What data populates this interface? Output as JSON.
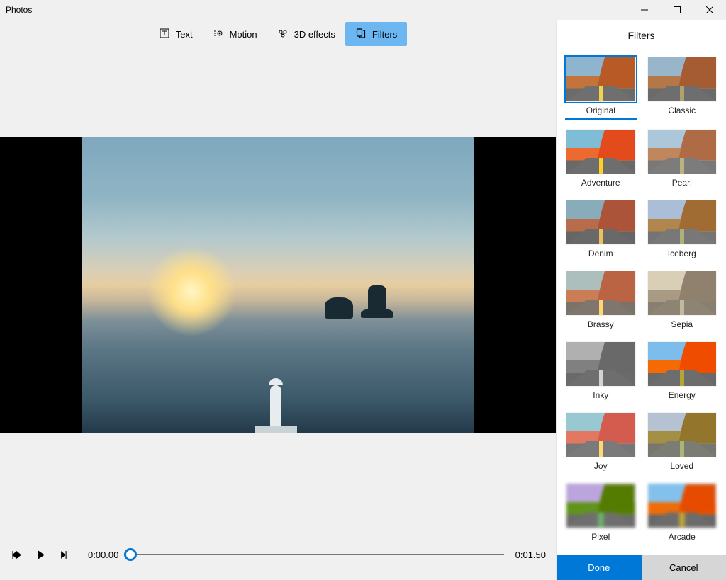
{
  "app": {
    "title": "Photos"
  },
  "window_controls": {
    "minimize": "minimize",
    "maximize": "maximize",
    "close": "close"
  },
  "toolbar": {
    "items": [
      {
        "id": "text",
        "label": "Text",
        "icon": "text-icon",
        "active": false
      },
      {
        "id": "motion",
        "label": "Motion",
        "icon": "motion-icon",
        "active": false
      },
      {
        "id": "3deffects",
        "label": "3D effects",
        "icon": "3d-effects-icon",
        "active": false
      },
      {
        "id": "filters",
        "label": "Filters",
        "icon": "filters-icon",
        "active": true
      }
    ]
  },
  "playback": {
    "prev_frame_icon": "step-back-icon",
    "play_icon": "play-icon",
    "next_frame_icon": "step-forward-icon",
    "current_time": "0:00.00",
    "end_time": "0:01.50",
    "position_percent": 0
  },
  "panel": {
    "title": "Filters",
    "done_label": "Done",
    "cancel_label": "Cancel",
    "selected": "original",
    "filters": [
      {
        "id": "original",
        "label": "Original",
        "tint": ""
      },
      {
        "id": "classic",
        "label": "Classic",
        "tint": "tint-classic"
      },
      {
        "id": "adventure",
        "label": "Adventure",
        "tint": "tint-adventure"
      },
      {
        "id": "pearl",
        "label": "Pearl",
        "tint": "tint-pearl"
      },
      {
        "id": "denim",
        "label": "Denim",
        "tint": "tint-denim"
      },
      {
        "id": "iceberg",
        "label": "Iceberg",
        "tint": "tint-iceberg"
      },
      {
        "id": "brassy",
        "label": "Brassy",
        "tint": "tint-brassy"
      },
      {
        "id": "sepia",
        "label": "Sepia",
        "tint": "tint-sepia"
      },
      {
        "id": "inky",
        "label": "Inky",
        "tint": "tint-inky"
      },
      {
        "id": "energy",
        "label": "Energy",
        "tint": "tint-energy"
      },
      {
        "id": "joy",
        "label": "Joy",
        "tint": "tint-joy"
      },
      {
        "id": "loved",
        "label": "Loved",
        "tint": "tint-loved"
      },
      {
        "id": "pixel",
        "label": "Pixel",
        "tint": "tint-pixel pixelated"
      },
      {
        "id": "arcade",
        "label": "Arcade",
        "tint": "tint-arcade pixelated"
      }
    ]
  }
}
